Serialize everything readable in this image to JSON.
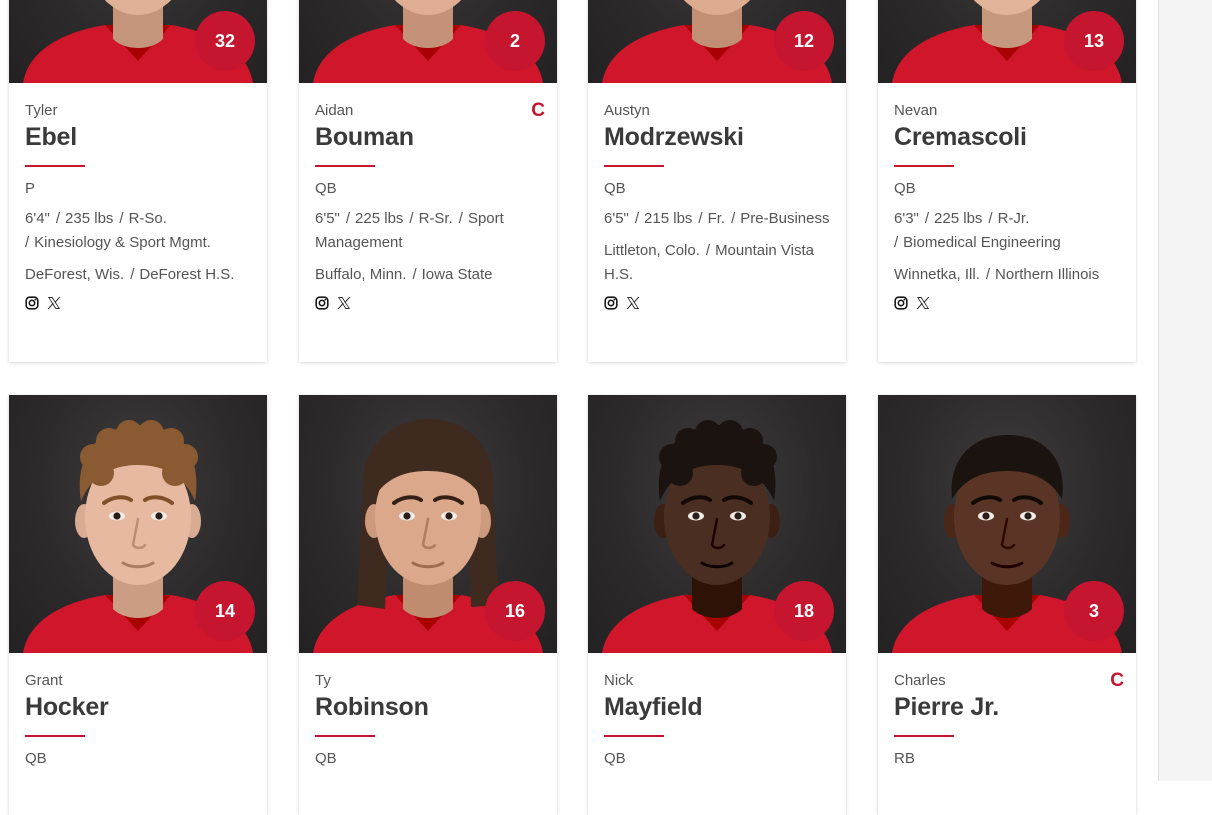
{
  "cards": [
    {
      "first": "Tyler",
      "last": "Ebel",
      "number": "32",
      "captain": "",
      "position": "P",
      "height": "6'4\"",
      "weight": "235 lbs",
      "year": "R-So.",
      "major": "Kinesiology & Sport Mgmt.",
      "hometown": "DeForest, Wis.",
      "school": "DeForest H.S.",
      "skin": "#e0b097",
      "hair": "#6a4a33",
      "hair_style": "short"
    },
    {
      "first": "Aidan",
      "last": "Bouman",
      "number": "2",
      "captain": "C",
      "position": "QB",
      "height": "6'5\"",
      "weight": "225 lbs",
      "year": "R-Sr.",
      "major": "Sport Management",
      "hometown": "Buffalo, Minn.",
      "school": "Iowa State",
      "skin": "#dfae94",
      "hair": "#5a3d2a",
      "hair_style": "short"
    },
    {
      "first": "Austyn",
      "last": "Modrzewski",
      "number": "12",
      "captain": "",
      "position": "QB",
      "height": "6'5\"",
      "weight": "215 lbs",
      "year": "Fr.",
      "major": "Pre-Business",
      "hometown": "Littleton, Colo.",
      "school": "Mountain Vista H.S.",
      "skin": "#dcab90",
      "hair": "#3d2a1e",
      "hair_style": "short"
    },
    {
      "first": "Nevan",
      "last": "Cremascoli",
      "number": "13",
      "captain": "",
      "position": "QB",
      "height": "6'3\"",
      "weight": "225 lbs",
      "year": "R-Jr.",
      "major": "Biomedical Engineering",
      "hometown": "Winnetka, Ill.",
      "school": "Northern Illinois",
      "skin": "#e2b49a",
      "hair": "#4a3324",
      "hair_style": "short"
    },
    {
      "first": "Grant",
      "last": "Hocker",
      "number": "14",
      "captain": "",
      "position": "QB",
      "skin": "#e6b9a0",
      "hair": "#8a5a32",
      "hair_style": "curly"
    },
    {
      "first": "Ty",
      "last": "Robinson",
      "number": "16",
      "captain": "",
      "position": "QB",
      "skin": "#dba88c",
      "hair": "#3e2a1f",
      "hair_style": "long"
    },
    {
      "first": "Nick",
      "last": "Mayfield",
      "number": "18",
      "captain": "",
      "position": "QB",
      "skin": "#4a2e22",
      "hair": "#1a1310",
      "hair_style": "curly"
    },
    {
      "first": "Charles",
      "last": "Pierre Jr.",
      "number": "3",
      "captain": "C",
      "position": "RB",
      "skin": "#5a3526",
      "hair": "#1a1310",
      "hair_style": "short"
    }
  ],
  "social_icons": [
    "instagram-icon",
    "x-twitter-icon"
  ],
  "colors": {
    "accent": "#c5152f",
    "jersey": "#d0162b",
    "photo_bg": "#2c2a2b",
    "text_dark": "#3a3a3a",
    "text_muted": "#555555"
  }
}
